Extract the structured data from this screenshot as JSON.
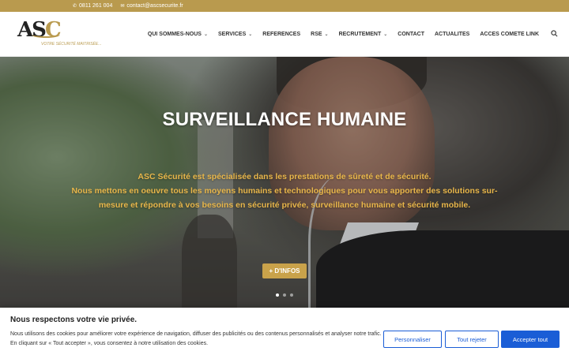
{
  "topbar": {
    "phone": "0811 261 004",
    "email": "contact@ascsecurite.fr",
    "phone_icon": "phone-icon",
    "email_icon": "envelope-icon"
  },
  "logo": {
    "mark_a": "AS",
    "mark_c": "C",
    "tagline": "VOTRE SÉCURITÉ MAITRISÉE..."
  },
  "nav": {
    "items": [
      {
        "label": "QUI SOMMES-NOUS",
        "has_dropdown": true
      },
      {
        "label": "SERVICES",
        "has_dropdown": true
      },
      {
        "label": "REFERENCES",
        "has_dropdown": false
      },
      {
        "label": "RSE",
        "has_dropdown": true
      },
      {
        "label": "RECRUTEMENT",
        "has_dropdown": true
      },
      {
        "label": "CONTACT",
        "has_dropdown": false
      },
      {
        "label": "ACTUALITES",
        "has_dropdown": false
      },
      {
        "label": "ACCES COMETE LINK",
        "has_dropdown": false
      }
    ],
    "search_icon": "search-icon"
  },
  "hero": {
    "title": "SURVEILLANCE HUMAINE",
    "line1": "ASC Sécurité est spécialisée dans les prestations de sûreté et de sécurité.",
    "line2": "Nous mettons en oeuvre tous les moyens humains et technologiques pour vous apporter des solutions sur-mesure et répondre à vos besoins en sécurité privée, surveillance humaine et sécurité mobile.",
    "cta_label": "+ D'INFOS",
    "slides": 3,
    "active_slide": 1
  },
  "cookie": {
    "title": "Nous respectons votre vie privée.",
    "text": "Nous utilisons des cookies pour améliorer votre expérience de navigation, diffuser des publicités ou des contenus personnalisés et analyser notre trafic. En cliquant sur « Tout accepter », vous consentez à notre utilisation des cookies.",
    "personnaliser": "Personnaliser",
    "refuser": "Tout rejeter",
    "accepter": "Accepter tout"
  },
  "colors": {
    "gold": "#b99a4e",
    "hero_text": "#e8b64a",
    "button_blue": "#1a5dd6"
  }
}
